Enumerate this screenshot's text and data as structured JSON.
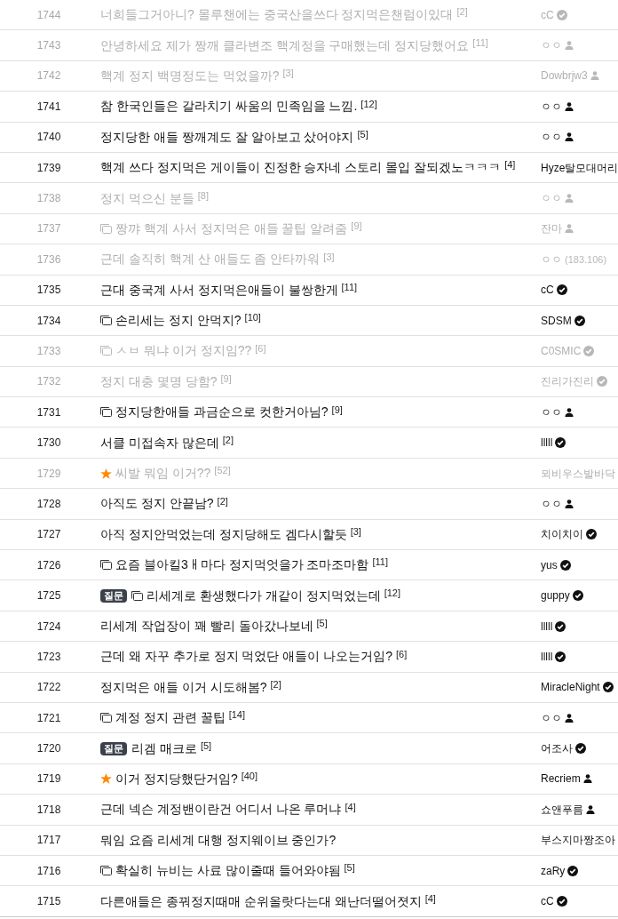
{
  "rows": [
    {
      "number": "1744",
      "visited": true,
      "kind": "text",
      "title": "너희들그거아니? 몰루챈에는 중국산을쓰다 정지먹은챈럼이있대",
      "comments": "[2]",
      "author": {
        "name": "cC",
        "kind": "verified"
      }
    },
    {
      "number": "1743",
      "visited": true,
      "kind": "text",
      "title": "안녕하세요 제가 짱깨 클라변조 핵계정을 구매했는데 정지당했어요",
      "comments": "[11]",
      "author": {
        "name": "ㅇㅇ",
        "kind": "member"
      }
    },
    {
      "number": "1742",
      "visited": true,
      "kind": "text",
      "title": "핵계 정지 백명정도는 먹었을까?",
      "comments": "[3]",
      "author": {
        "name": "Dowbrjw3",
        "kind": "member"
      }
    },
    {
      "number": "1741",
      "visited": false,
      "kind": "text",
      "title": "참 한국인들은 갈라치기 싸움의 민족임을 느낌.",
      "comments": "[12]",
      "author": {
        "name": "ㅇㅇ",
        "kind": "member"
      }
    },
    {
      "number": "1740",
      "visited": false,
      "kind": "text",
      "title": "정지당한 애들 짱깨계도 잘 알아보고 샀어야지",
      "comments": "[5]",
      "author": {
        "name": "ㅇㅇ",
        "kind": "member"
      }
    },
    {
      "number": "1739",
      "visited": false,
      "kind": "text",
      "title": "핵계 쓰다 정지먹은 게이들이 진정한 승자네 스토리 몰입 잘되겠노ㅋㅋㅋ",
      "comments": "[4]",
      "author": {
        "name": "Hyze탈모대머리"
      }
    },
    {
      "number": "1738",
      "visited": true,
      "kind": "text",
      "title": "정지 먹으신 분들",
      "comments": "[8]",
      "author": {
        "name": "ㅇㅇ",
        "kind": "member"
      }
    },
    {
      "number": "1737",
      "visited": true,
      "kind": "image",
      "title": "짱꺄 핵계 사서 정지먹은 애들 꿀팁 알려줌",
      "comments": "[9]",
      "author": {
        "name": "잔마",
        "kind": "member"
      }
    },
    {
      "number": "1736",
      "visited": true,
      "kind": "text",
      "title": "근데 솔직히 핵계 산 애들도 좀 안타까워",
      "comments": "[3]",
      "author": {
        "name": "ㅇㅇ",
        "ip": "(183.106)"
      }
    },
    {
      "number": "1735",
      "visited": false,
      "kind": "text",
      "title": "근대 중국계 사서 정지먹은애들이 불쌍한게",
      "comments": "[11]",
      "author": {
        "name": "cC",
        "kind": "verified"
      }
    },
    {
      "number": "1734",
      "visited": false,
      "kind": "image",
      "title": "손리세는 정지 안먹지?",
      "comments": "[10]",
      "author": {
        "name": "SDSM",
        "kind": "verified"
      }
    },
    {
      "number": "1733",
      "visited": true,
      "kind": "image",
      "title": "ㅅㅂ 뭐냐 이거 정지임??",
      "comments": "[6]",
      "author": {
        "name": "C0SMIC",
        "kind": "verified"
      }
    },
    {
      "number": "1732",
      "visited": true,
      "kind": "text",
      "title": "정지 대충 몇명 당함?",
      "comments": "[9]",
      "author": {
        "name": "진리가진리",
        "kind": "verified"
      }
    },
    {
      "number": "1731",
      "visited": false,
      "kind": "image",
      "title": "정지당한애들 과금순으로 컷한거아님?",
      "comments": "[9]",
      "author": {
        "name": "ㅇㅇ",
        "kind": "member"
      }
    },
    {
      "number": "1730",
      "visited": false,
      "kind": "text",
      "title": "서클 미접속자 많은데",
      "comments": "[2]",
      "author": {
        "name": "lllll",
        "kind": "verified"
      }
    },
    {
      "number": "1729",
      "visited": true,
      "kind": "featured",
      "title": "씨발 뭐임 이거??",
      "comments": "[52]",
      "author": {
        "name": "뫼비우스발바닥"
      }
    },
    {
      "number": "1728",
      "visited": false,
      "kind": "text",
      "title": "아직도 정지 안끝남?",
      "comments": "[2]",
      "author": {
        "name": "ㅇㅇ",
        "kind": "member"
      }
    },
    {
      "number": "1727",
      "visited": false,
      "kind": "text",
      "title": "아직 정지안먹었는데 정지당해도 겜다시할듯",
      "comments": "[3]",
      "author": {
        "name": "치이치이",
        "kind": "verified"
      }
    },
    {
      "number": "1726",
      "visited": false,
      "kind": "image",
      "title": "요즘 블아킬3ㅐ마다 정지먹엇을가 조마조마함",
      "comments": "[11]",
      "author": {
        "name": "yus",
        "kind": "verified"
      }
    },
    {
      "number": "1725",
      "visited": false,
      "kind": "image",
      "tag": "질문",
      "title": "리세계로 환생했다가 개같이 정지먹었는데",
      "comments": "[12]",
      "author": {
        "name": "guppy",
        "kind": "verified"
      }
    },
    {
      "number": "1724",
      "visited": false,
      "kind": "text",
      "title": "리세계 작업장이 꽤 빨리 돌아갔나보네",
      "comments": "[5]",
      "author": {
        "name": "lllll",
        "kind": "verified"
      }
    },
    {
      "number": "1723",
      "visited": false,
      "kind": "text",
      "title": "근데 왜 자꾸 추가로 정지 먹었단 애들이 나오는거임?",
      "comments": "[6]",
      "author": {
        "name": "lllll",
        "kind": "verified"
      }
    },
    {
      "number": "1722",
      "visited": false,
      "kind": "text",
      "title": "정지먹은 애들 이거 시도해봄?",
      "comments": "[2]",
      "author": {
        "name": "MiracleNight",
        "kind": "verified"
      }
    },
    {
      "number": "1721",
      "visited": false,
      "kind": "image",
      "title": "계정 정지 관련 꿀팁",
      "comments": "[14]",
      "author": {
        "name": "ㅇㅇ",
        "kind": "member"
      }
    },
    {
      "number": "1720",
      "visited": false,
      "kind": "text",
      "tag": "질문",
      "title": "리겜 매크로",
      "comments": "[5]",
      "author": {
        "name": "어조사",
        "kind": "verified"
      }
    },
    {
      "number": "1719",
      "visited": false,
      "kind": "featured",
      "title": "이거 정지당했단거임?",
      "comments": "[40]",
      "author": {
        "name": "Recriem",
        "kind": "member"
      }
    },
    {
      "number": "1718",
      "visited": false,
      "kind": "text",
      "title": "근데 넥슨 계정밴이란건 어디서 나온 루머냐",
      "comments": "[4]",
      "author": {
        "name": "쇼앤푸름",
        "kind": "member"
      }
    },
    {
      "number": "1717",
      "visited": false,
      "kind": "text",
      "title": "뭐임 요즘 리세계 대행 정지웨이브 중인가?",
      "author": {
        "name": "부스지마짱조아"
      }
    },
    {
      "number": "1716",
      "visited": false,
      "kind": "image",
      "title": "확실히 뉴비는 사료 많이줄때 들어와야됨",
      "comments": "[5]",
      "author": {
        "name": "zaRy",
        "kind": "verified"
      }
    },
    {
      "number": "1715",
      "visited": false,
      "kind": "text",
      "title": "다른애들은 종꿔정지때매 순위올랏다는대 왜난더떨어졋지",
      "comments": "[4]",
      "author": {
        "name": "cC",
        "kind": "verified"
      }
    }
  ]
}
